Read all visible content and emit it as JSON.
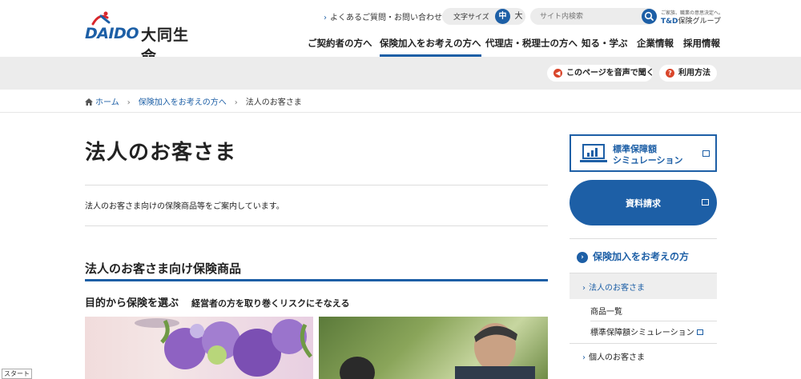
{
  "header": {
    "logo_text": "DAIDO",
    "logo_jp": "大同生命",
    "faq_link": "よくあるご質問・お問い合わせ",
    "text_size": {
      "label": "文字サイズ",
      "medium": "中",
      "large": "大"
    },
    "search": {
      "placeholder": "サイト内検索"
    },
    "group": {
      "tagline": "ご家族、職業の意思決定へ。",
      "brand_td": "T&D",
      "brand_rest": "保険グループ"
    }
  },
  "nav": {
    "items": [
      {
        "label": "ご契約者の方へ"
      },
      {
        "label": "保険加入をお考えの方へ",
        "active": true
      },
      {
        "label": "代理店・税理士の方へ"
      },
      {
        "label": "知る・学ぶ"
      },
      {
        "label": "企業情報"
      },
      {
        "label": "採用情報"
      }
    ]
  },
  "toolbar": {
    "read_aloud": "このページを音声で聞く",
    "usage": "利用方法"
  },
  "breadcrumb": {
    "home": "ホーム",
    "parent": "保険加入をお考えの方へ",
    "current": "法人のお客さま"
  },
  "main": {
    "title": "法人のお客さま",
    "lead": "法人のお客さま向けの保険商品等をご案内しています。",
    "section_title": "法人のお客さま向け保険商品",
    "sub_title": "目的から保険を選ぶ",
    "sub_note": "経営者の方を取り巻くリスクにそなえる"
  },
  "sidebar": {
    "simulation": "標準保障額\nシミュレーション",
    "request": "資料請求",
    "section_head": "保険加入をお考えの方",
    "active_item": "法人のお客さま",
    "sub_items": [
      "商品一覧",
      "標準保障額シミュレーション"
    ],
    "next_item": "個人のお客さま"
  },
  "footer": {
    "start_label": "スタート"
  },
  "colors": {
    "brand_blue": "#1d5fa6",
    "accent_red": "#d9262b",
    "toolbar_gray": "#ececec"
  }
}
